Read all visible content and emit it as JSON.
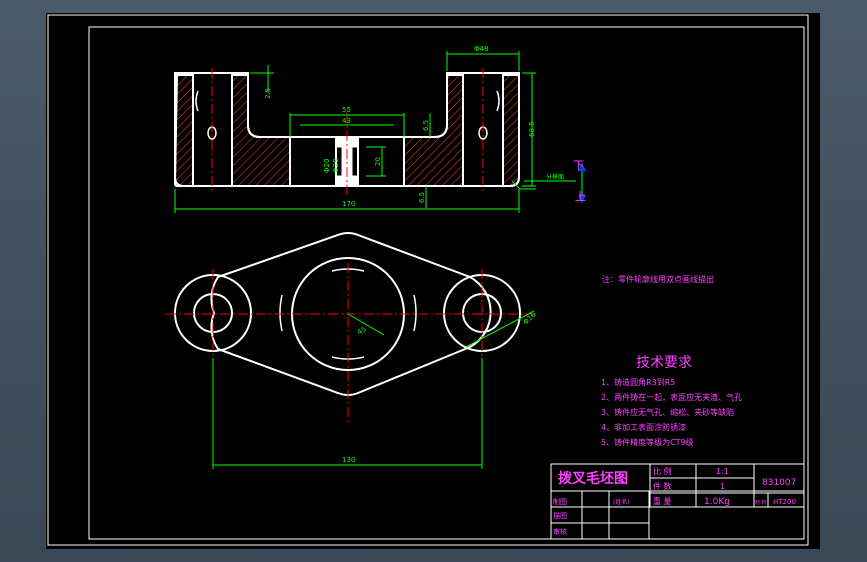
{
  "colors": {
    "background": "#000000",
    "outline": "#ffffff",
    "dimension": "#00ff00",
    "centerline": "#ff0000",
    "hatch": "#ff4040",
    "note": "#ff40ff",
    "frame": "#ffffff",
    "titleblock": "#ff40ff",
    "arrow": "#0040ff",
    "window_bg": "#3f4d5a"
  },
  "front_view": {
    "dim_width_top_right": "Φ48",
    "dim_height_right": "60.5",
    "dim_top_left": "2.5",
    "dim_55": "55",
    "dim_43": "43",
    "dim_center_height": "20",
    "dim_bore_small": "Φ20",
    "dim_bore_large": "Φ28",
    "dim_step_top": "6.5",
    "dim_step_bottom": "6.5",
    "dim_overall": "170",
    "parting_label": "分模面",
    "label_top": "下",
    "label_bottom": "上"
  },
  "top_view": {
    "dim_center_distance": "130",
    "dim_big_bore": "45",
    "dim_small_bore": "Φ16"
  },
  "notes": {
    "parting_note": "注：零件轮廓线用双点画线描出",
    "tech_title": "技术要求",
    "items": [
      "1、铸造圆角R3到R5",
      "2、两件铸在一起，表面应无夹渣、气孔",
      "3、铸件应无气孔、缩松、夹砂等缺陷",
      "4、非加工表面涂防锈漆",
      "5、铸件精度等级为CT9级"
    ]
  },
  "titleblock": {
    "title": "拨叉毛坯图",
    "scale_label": "比 例",
    "scale_value": "1:1",
    "qty_label": "件 数",
    "qty_value": "1",
    "weight_label": "重 量",
    "weight_value": "1.0Kg",
    "material_label": "材 料",
    "material_value": "HT200",
    "drawing_no": "831007",
    "row_draw": "制图",
    "row_draw_name": "(姓名)",
    "row_check": "描图",
    "row_review": "审核"
  }
}
